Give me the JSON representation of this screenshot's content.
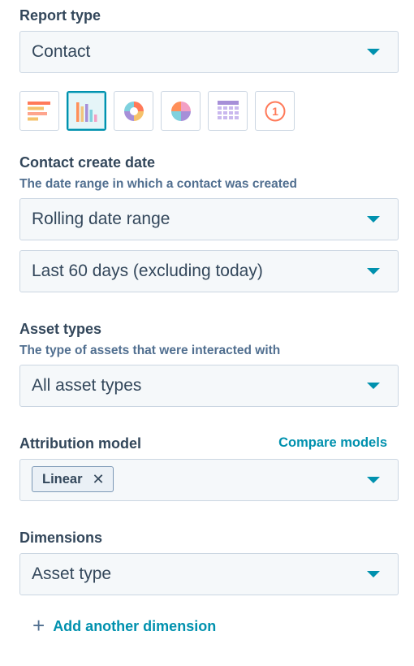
{
  "report_type": {
    "label": "Report type",
    "value": "Contact"
  },
  "visualizations": [
    {
      "icon": "horizontal-bar-chart-icon",
      "active": false
    },
    {
      "icon": "vertical-bar-chart-icon",
      "active": true
    },
    {
      "icon": "donut-chart-icon",
      "active": false
    },
    {
      "icon": "pie-chart-icon",
      "active": false
    },
    {
      "icon": "table-icon",
      "active": false
    },
    {
      "icon": "single-value-icon",
      "active": false,
      "text": "1"
    }
  ],
  "create_date": {
    "label": "Contact create date",
    "help": "The date range in which a contact was created",
    "range_type": "Rolling date range",
    "range_value": "Last 60 days (excluding today)"
  },
  "asset_types": {
    "label": "Asset types",
    "help": "The type of assets that were interacted with",
    "value": "All asset types"
  },
  "attribution": {
    "label": "Attribution model",
    "compare_link": "Compare models",
    "tag": "Linear",
    "remove_symbol": "✕"
  },
  "dimensions": {
    "label": "Dimensions",
    "value": "Asset type",
    "add_symbol": "+",
    "add_label": "Add another dimension"
  },
  "colors": {
    "accent": "#0091ae",
    "text": "#33475b",
    "help_text": "#516f90",
    "input_bg": "#f5f8fa",
    "border": "#cbd6e2"
  }
}
